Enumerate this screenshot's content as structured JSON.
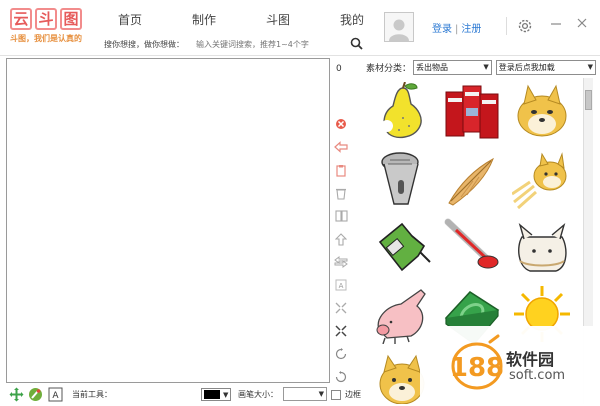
{
  "logo": {
    "chars": [
      "云",
      "斗",
      "图"
    ],
    "slogan": "斗图，我们是认真的"
  },
  "nav": [
    "首页",
    "制作",
    "斗图",
    "我的"
  ],
  "search": {
    "label": "搜你想搜，做你想做：",
    "placeholder": "输入关键词搜索，推荐1~4个字"
  },
  "auth": {
    "login": "登录",
    "register": "注册"
  },
  "canvas": {
    "count": "0"
  },
  "materials": {
    "category_label": "素材分类：",
    "category_value": "丢出物品",
    "login_hint": "登录后点我加载"
  },
  "bottom": {
    "current_tool_label": "当前工具：",
    "pen_size_label": "画笔大小：",
    "border_label": "边框",
    "color": "#000000"
  },
  "watermark": {
    "name": "软件园",
    "url": "soft.com",
    "number": "188"
  },
  "stickers": [
    "pear",
    "red-boxes",
    "doge-face",
    "microphone",
    "feather",
    "doge-flying",
    "bottle",
    "thermometer",
    "rice-bag",
    "pig",
    "soap",
    "sun",
    "doge-small"
  ],
  "colors": {
    "link": "#2b79d3",
    "logo_red": "#e65b5b",
    "logo_orange": "#e7903f",
    "watermark_orange": "#f39a21"
  }
}
